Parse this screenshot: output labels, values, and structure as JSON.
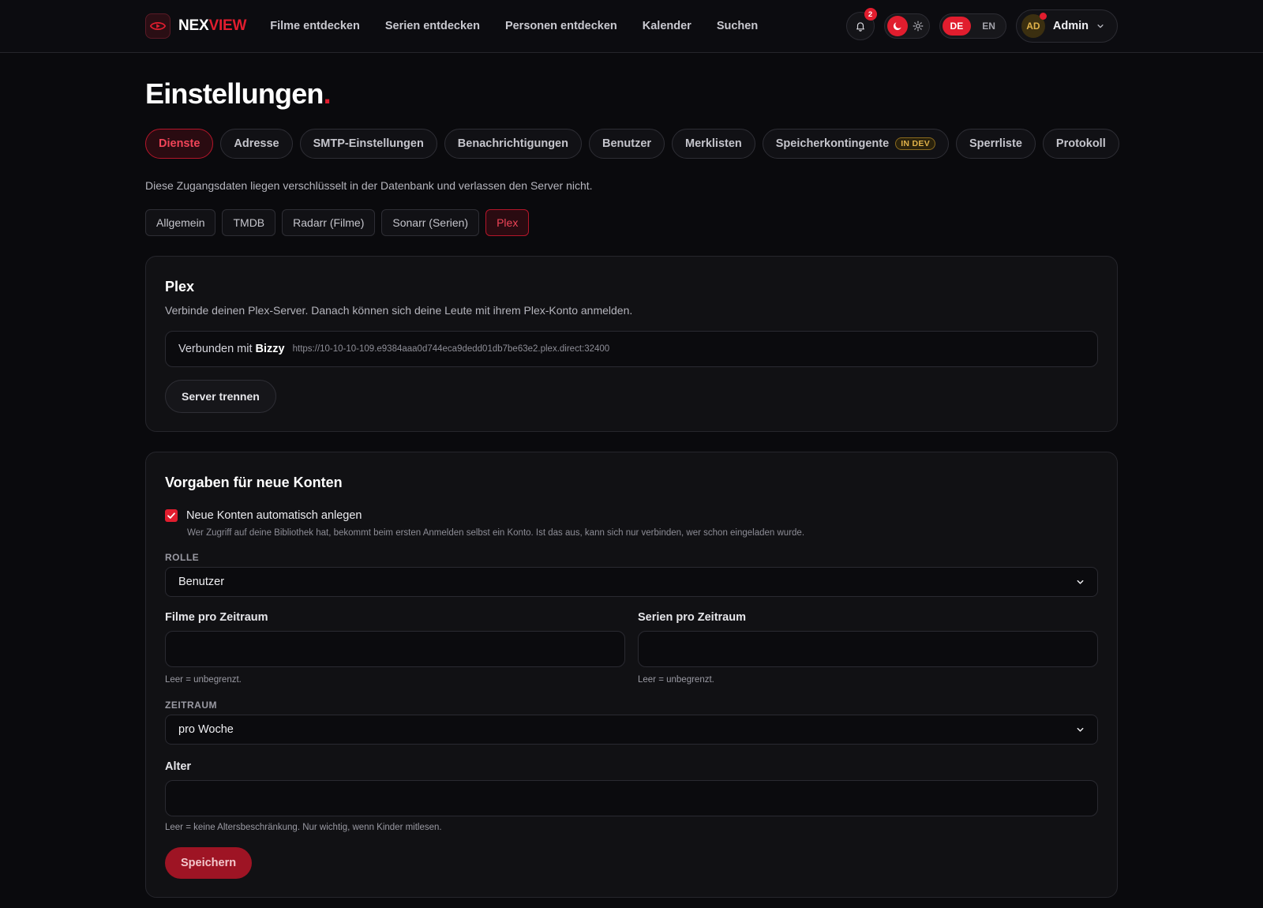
{
  "brand": {
    "part1": "NEX",
    "part2": "VIEW"
  },
  "nav": {
    "links": [
      "Filme entdecken",
      "Serien entdecken",
      "Personen entdecken",
      "Kalender",
      "Suchen"
    ],
    "notification_count": "2",
    "languages": [
      "DE",
      "EN"
    ],
    "active_language": "DE",
    "user_initials": "AD",
    "user_name": "Admin"
  },
  "page": {
    "title": "Einstellungen",
    "title_dot": "."
  },
  "tabs": [
    {
      "label": "Dienste",
      "active": true
    },
    {
      "label": "Adresse"
    },
    {
      "label": "SMTP-Einstellungen"
    },
    {
      "label": "Benachrichtigungen"
    },
    {
      "label": "Benutzer"
    },
    {
      "label": "Merklisten"
    },
    {
      "label": "Speicherkontingente",
      "badge": "IN DEV"
    },
    {
      "label": "Sperrliste"
    },
    {
      "label": "Protokoll"
    }
  ],
  "intro": "Diese Zugangsdaten liegen verschlüsselt in der Datenbank und verlassen den Server nicht.",
  "subtabs": [
    {
      "label": "Allgemein"
    },
    {
      "label": "TMDB"
    },
    {
      "label": "Radarr (Filme)"
    },
    {
      "label": "Sonarr (Serien)"
    },
    {
      "label": "Plex",
      "active": true
    }
  ],
  "plex": {
    "title": "Plex",
    "description": "Verbinde deinen Plex-Server. Danach können sich deine Leute mit ihrem Plex-Konto anmelden.",
    "connected_prefix": "Verbunden mit",
    "server_name": "Bizzy",
    "server_url": "https://10-10-10-109.e9384aaa0d744eca9dedd01db7be63e2.plex.direct:32400",
    "disconnect_label": "Server trennen"
  },
  "defaults": {
    "title": "Vorgaben für neue Konten",
    "auto_create_label": "Neue Konten automatisch anlegen",
    "auto_create_checked": true,
    "auto_create_help": "Wer Zugriff auf deine Bibliothek hat, bekommt beim ersten Anmelden selbst ein Konto. Ist das aus, kann sich nur verbinden, wer schon eingeladen wurde.",
    "role_label": "ROLLE",
    "role_value": "Benutzer",
    "movies_label": "Filme pro Zeitraum",
    "movies_value": "",
    "movies_help": "Leer = unbegrenzt.",
    "series_label": "Serien pro Zeitraum",
    "series_value": "",
    "series_help": "Leer = unbegrenzt.",
    "period_label": "ZEITRAUM",
    "period_value": "pro Woche",
    "age_label": "Alter",
    "age_value": "",
    "age_help": "Leer = keine Altersbeschränkung. Nur wichtig, wenn Kinder mitlesen.",
    "save_label": "Speichern"
  },
  "colors": {
    "accent": "#e11d2e",
    "background": "#0a0a0d",
    "card": "#111114",
    "dev_badge": "#e0b24a"
  }
}
